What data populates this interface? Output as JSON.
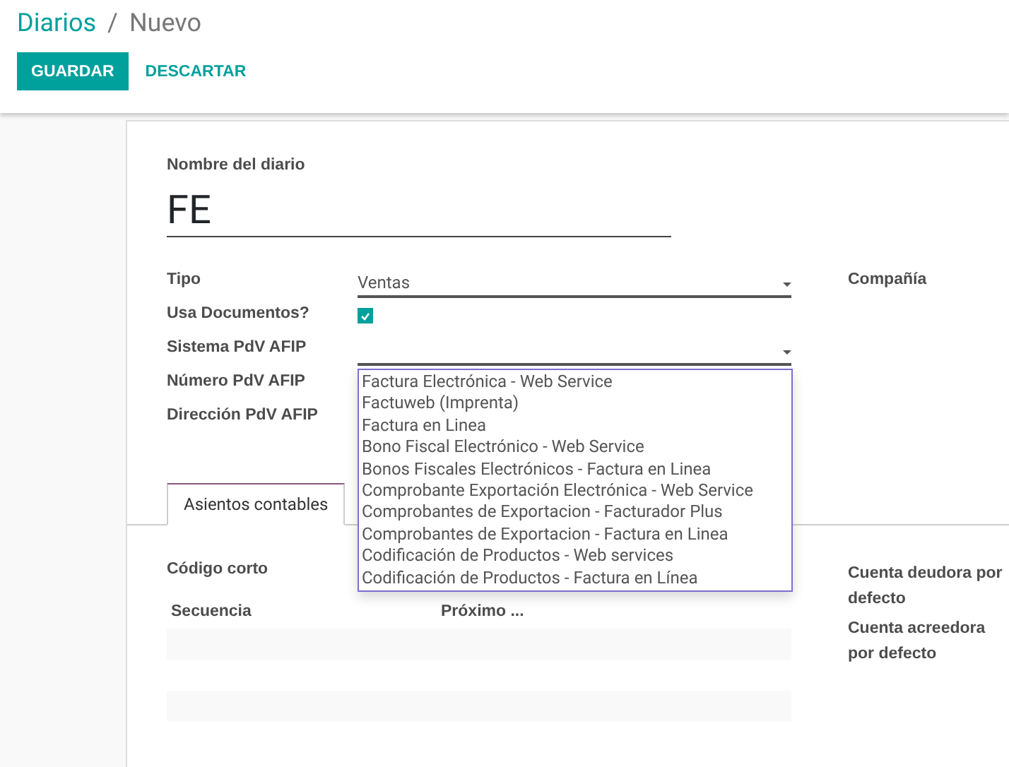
{
  "breadcrumb": {
    "parent": "Diarios",
    "separator": "/",
    "current": "Nuevo"
  },
  "buttons": {
    "save": "GUARDAR",
    "discard": "DESCARTAR"
  },
  "form": {
    "name_label": "Nombre del diario",
    "name_value": "FE",
    "fields": [
      {
        "label": "Tipo",
        "kind": "select",
        "value": "Ventas"
      },
      {
        "label": "Usa Documentos?",
        "kind": "checkbox",
        "checked": true
      },
      {
        "label": "Sistema PdV AFIP",
        "kind": "select"
      },
      {
        "label": "Número PdV AFIP",
        "kind": "blank"
      },
      {
        "label": "Dirección PdV AFIP",
        "kind": "blank"
      }
    ],
    "right_label": "Compañía"
  },
  "dropdown": [
    "Factura Electrónica - Web Service",
    "Factuweb (Imprenta)",
    "Factura en Linea",
    "Bono Fiscal Electrónico - Web Service",
    "Bonos Fiscales Electrónicos - Factura en Linea",
    "Comprobante Exportación Electrónica - Web Service",
    "Comprobantes de Exportacion - Facturador Plus",
    "Comprobantes de Exportacion - Factura en Linea",
    "Codificación de Productos - Web services",
    "Codificación de Productos - Factura en Línea"
  ],
  "tabs": [
    {
      "label": "Asientos contables",
      "selected": true
    }
  ],
  "tab_content": {
    "short_code_label": "Código corto",
    "table": {
      "columns": [
        "Secuencia",
        "Próximo ..."
      ]
    },
    "right_labels": [
      "Cuenta deudora por defecto",
      "Cuenta acreedora por defecto"
    ]
  }
}
